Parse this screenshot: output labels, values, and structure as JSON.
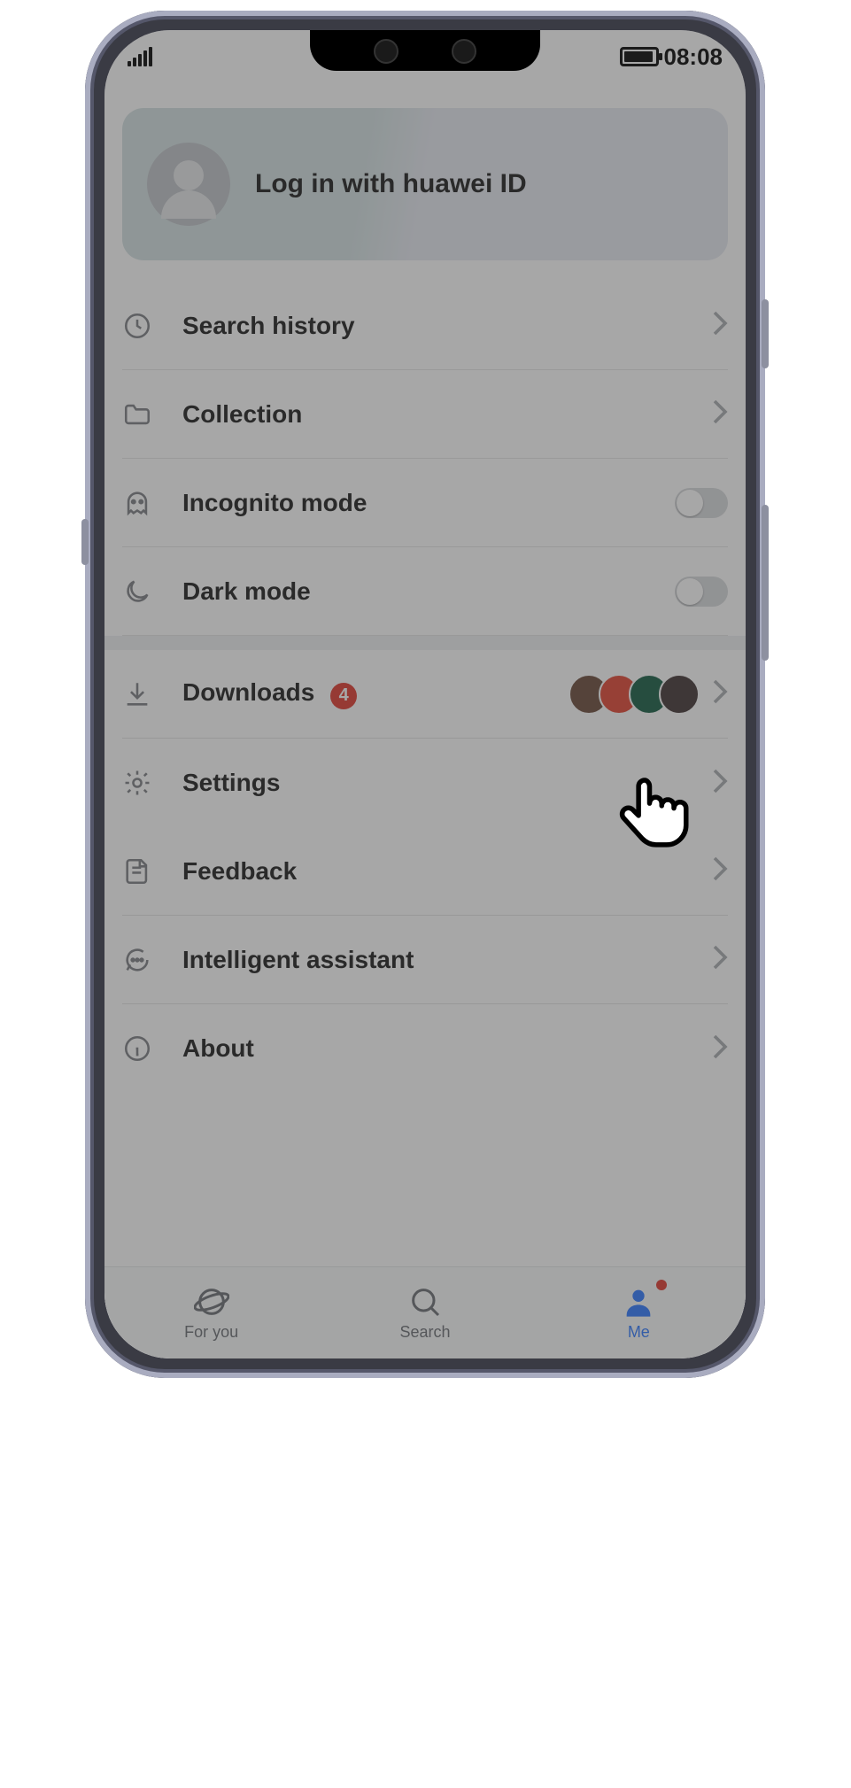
{
  "status": {
    "time": "08:08"
  },
  "account": {
    "login_label": "Log in with huawei ID"
  },
  "menu": {
    "search_history": "Search history",
    "collection": "Collection",
    "incognito": "Incognito mode",
    "dark_mode": "Dark mode",
    "downloads": {
      "label": "Downloads",
      "badge": "4"
    },
    "settings": "Settings",
    "feedback": "Feedback",
    "assistant": "Intelligent assistant",
    "about": "About"
  },
  "nav": {
    "for_you": "For you",
    "search": "Search",
    "me": "Me"
  },
  "toggles": {
    "incognito_on": false,
    "dark_mode_on": false
  }
}
